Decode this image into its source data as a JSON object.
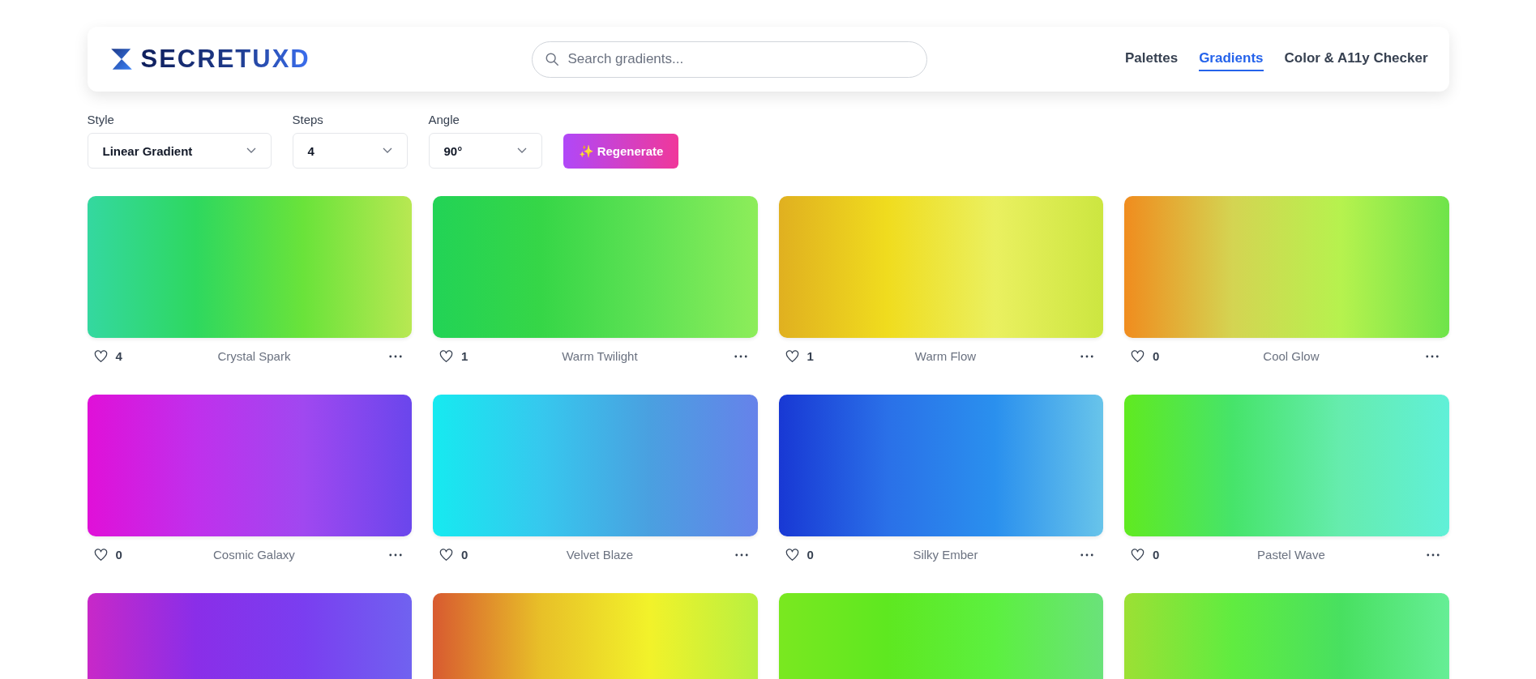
{
  "header": {
    "logo": "SECRETUXD",
    "search": {
      "placeholder": "Search gradients..."
    },
    "nav": [
      {
        "label": "Palettes",
        "selected": false
      },
      {
        "label": "Gradients",
        "selected": true
      },
      {
        "label": "Color & A11y Checker",
        "selected": false
      }
    ]
  },
  "controls": [
    {
      "label": "Style",
      "value": "Linear Gradient"
    },
    {
      "label": "Steps",
      "value": "4"
    },
    {
      "label": "Angle",
      "value": "90°"
    }
  ],
  "regenerate": {
    "icon": "✨",
    "label": "Regenerate"
  },
  "cards": [
    {
      "name": "Crystal Spark",
      "likes": "4",
      "stops": [
        {
          "color": "#34d8a0"
        },
        {
          "color": "#2ed85f"
        },
        {
          "color": "#6ae33a"
        },
        {
          "color": "#b8e852"
        }
      ]
    },
    {
      "name": "Warm Twilight",
      "likes": "1",
      "stops": [
        {
          "color": "#22d356"
        },
        {
          "color": "#36d647"
        },
        {
          "color": "#5fe254"
        },
        {
          "color": "#8ded5a"
        }
      ]
    },
    {
      "name": "Warm Flow",
      "likes": "1",
      "stops": [
        {
          "color": "#e0b020"
        },
        {
          "color": "#f0dc1e"
        },
        {
          "color": "#eaf060"
        },
        {
          "color": "#cce640"
        }
      ]
    },
    {
      "name": "Cool Glow",
      "likes": "0",
      "stops": [
        {
          "color": "#f08c1e"
        },
        {
          "color": "#d4d452"
        },
        {
          "color": "#b6f24e"
        },
        {
          "color": "#6ee44a"
        }
      ]
    },
    {
      "name": "Cosmic Galaxy",
      "likes": "0",
      "stops": [
        {
          "color": "#e010d8"
        },
        {
          "color": "#c030ec"
        },
        {
          "color": "#a048f0"
        },
        {
          "color": "#6a46ec"
        }
      ]
    },
    {
      "name": "Velvet Blaze",
      "likes": "0",
      "stops": [
        {
          "color": "#16eaf0"
        },
        {
          "color": "#36c8ee"
        },
        {
          "color": "#4aa0e0"
        },
        {
          "color": "#6682ea"
        }
      ]
    },
    {
      "name": "Silky Ember",
      "likes": "0",
      "stops": [
        {
          "color": "#1838d4"
        },
        {
          "color": "#2a70e8"
        },
        {
          "color": "#2a90ee"
        },
        {
          "color": "#68c4ea"
        }
      ]
    },
    {
      "name": "Pastel Wave",
      "likes": "0",
      "stops": [
        {
          "color": "#60ea20"
        },
        {
          "color": "#46e46a"
        },
        {
          "color": "#66ecae"
        },
        {
          "color": "#60f0d8"
        }
      ]
    },
    {
      "stops": [
        {
          "color": "#c828c8"
        },
        {
          "color": "#8a2ee8"
        },
        {
          "color": "#7a3ef0"
        },
        {
          "color": "#7062f0"
        }
      ]
    },
    {
      "stops": [
        {
          "color": "#d85a30"
        },
        {
          "color": "#e8c028"
        },
        {
          "color": "#f2f22a"
        },
        {
          "color": "#b8f040"
        }
      ]
    },
    {
      "stops": [
        {
          "color": "#7ae820"
        },
        {
          "color": "#5ee820"
        },
        {
          "color": "#5cf040"
        },
        {
          "color": "#6ae27a"
        }
      ]
    },
    {
      "stops": [
        {
          "color": "#9ce034"
        },
        {
          "color": "#60ec40"
        },
        {
          "color": "#48e060"
        },
        {
          "color": "#66ee96"
        }
      ]
    }
  ]
}
